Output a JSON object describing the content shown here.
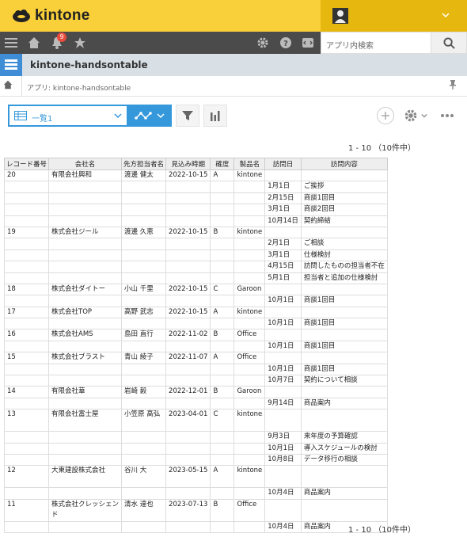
{
  "header": {
    "logo_text": "kintone"
  },
  "gnav": {
    "notification_count": "9",
    "search_placeholder": "アプリ内検索"
  },
  "app": {
    "name": "kintone-handsontable"
  },
  "breadcrumb": {
    "text": "アプリ: kintone-handsontable"
  },
  "toolbar": {
    "view_label": "一覧1"
  },
  "pager": {
    "top": "1 - 10 （10件中）",
    "bottom": "1 - 10 （10件中）"
  },
  "table": {
    "columns": [
      "レコード番号",
      "会社名",
      "先方担当者名",
      "見込み時期",
      "確度",
      "製品名",
      "訪問日",
      "訪問内容"
    ],
    "rows": [
      [
        "20",
        "有限会社興和",
        "渡邊 健太",
        "2022-10-15",
        "A",
        "kintone",
        "",
        ""
      ],
      [
        "",
        "",
        "",
        "",
        "",
        "",
        "1月1日",
        "ご挨拶"
      ],
      [
        "",
        "",
        "",
        "",
        "",
        "",
        "2月15日",
        "商談1回目"
      ],
      [
        "",
        "",
        "",
        "",
        "",
        "",
        "3月1日",
        "商談2回目"
      ],
      [
        "",
        "",
        "",
        "",
        "",
        "",
        "10月14日",
        "契約締結"
      ],
      [
        "19",
        "株式会社ジール",
        "渡邊 久恵",
        "2022-10-15",
        "B",
        "kintone",
        "",
        ""
      ],
      [
        "",
        "",
        "",
        "",
        "",
        "",
        "2月1日",
        "ご相談"
      ],
      [
        "",
        "",
        "",
        "",
        "",
        "",
        "3月1日",
        "仕様検討"
      ],
      [
        "",
        "",
        "",
        "",
        "",
        "",
        "4月15日",
        "訪問したものの担当者不在"
      ],
      [
        "",
        "",
        "",
        "",
        "",
        "",
        "5月1日",
        "担当者と追加の仕様検討"
      ],
      [
        "18",
        "株式会社ダイトー",
        "小山 千里",
        "2022-10-15",
        "C",
        "Garoon",
        "",
        ""
      ],
      [
        "",
        "",
        "",
        "",
        "",
        "",
        "10月1日",
        "商談1回目"
      ],
      [
        "17",
        "株式会社TOP",
        "高野 武志",
        "2022-10-15",
        "A",
        "kintone",
        "",
        ""
      ],
      [
        "",
        "",
        "",
        "",
        "",
        "",
        "10月1日",
        "商談1回目"
      ],
      [
        "16",
        "株式会社AMS",
        "島田 直行",
        "2022-11-02",
        "B",
        "Office",
        "",
        ""
      ],
      [
        "",
        "",
        "",
        "",
        "",
        "",
        "10月1日",
        "商談1回目"
      ],
      [
        "15",
        "株式会社ブラスト",
        "青山 綾子",
        "2022-11-07",
        "A",
        "Office",
        "",
        ""
      ],
      [
        "",
        "",
        "",
        "",
        "",
        "",
        "10月1日",
        "商談1回目"
      ],
      [
        "",
        "",
        "",
        "",
        "",
        "",
        "10月7日",
        "契約について相談"
      ],
      [
        "14",
        "有限会社華",
        "岩崎 毅",
        "2022-12-01",
        "B",
        "Garoon",
        "",
        ""
      ],
      [
        "",
        "",
        "",
        "",
        "",
        "",
        "9月14日",
        "商品案内"
      ],
      [
        "13",
        "有限会社富士屋",
        "小笠原 高弘",
        "2023-04-01",
        "C",
        "kintone",
        "",
        ""
      ],
      [
        "",
        "",
        "",
        "",
        "",
        "",
        "9月3日",
        "来年度の予算確認"
      ],
      [
        "",
        "",
        "",
        "",
        "",
        "",
        "10月1日",
        "導入スケジュールの検討"
      ],
      [
        "",
        "",
        "",
        "",
        "",
        "",
        "10月8日",
        "データ移行の相談"
      ],
      [
        "12",
        "大東建設株式会社",
        "谷川 大",
        "2023-05-15",
        "A",
        "kintone",
        "",
        ""
      ],
      [
        "",
        "",
        "",
        "",
        "",
        "",
        "10月4日",
        "商品案内"
      ],
      [
        "11",
        "株式会社クレッシェンド",
        "清水 達也",
        "2023-07-13",
        "B",
        "Office",
        "",
        ""
      ],
      [
        "",
        "",
        "",
        "",
        "",
        "",
        "10月4日",
        "商品案内"
      ]
    ]
  }
}
